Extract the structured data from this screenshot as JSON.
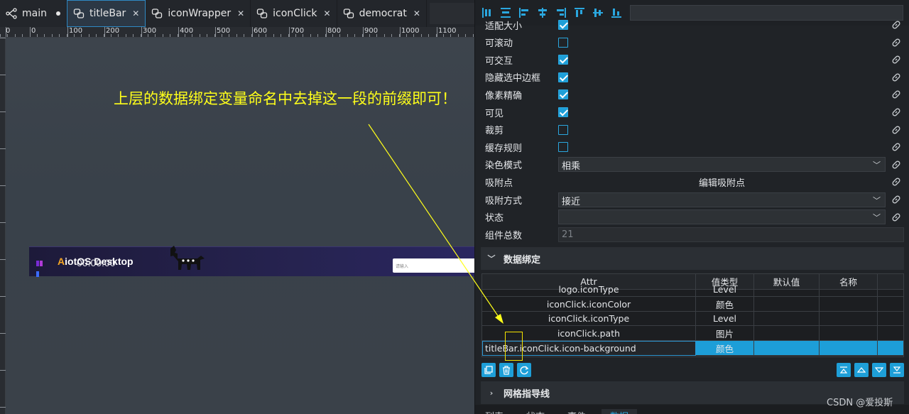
{
  "tabs": [
    {
      "label": "main",
      "dirty": true
    },
    {
      "label": "titleBar",
      "active": true
    },
    {
      "label": "iconWrapper"
    },
    {
      "label": "iconClick"
    },
    {
      "label": "democrat"
    }
  ],
  "ruler": {
    "labels": [
      "0",
      "0",
      "100",
      "200",
      "300",
      "400",
      "500",
      "600",
      "700",
      "800",
      "900",
      "1000",
      "1100"
    ]
  },
  "canvas": {
    "annotation": "上层的数据绑定变量命名中去掉这一段的前缀即可！",
    "preview": {
      "title_prefix": "A",
      "title_rest": "iotOS Desktop",
      "time": "00:00:00",
      "input_placeholder": "请输入"
    }
  },
  "toolbar": {
    "icons": [
      "align-left-edge-icon",
      "align-horizontal-center-icon",
      "align-left-icon",
      "align-center-icon",
      "align-right-icon",
      "align-top-icon",
      "align-middle-icon",
      "align-bottom-icon"
    ],
    "search_value": ""
  },
  "props": [
    {
      "label": "适配大小",
      "type": "checkbox",
      "checked": true
    },
    {
      "label": "可滚动",
      "type": "checkbox",
      "checked": false
    },
    {
      "label": "可交互",
      "type": "checkbox",
      "checked": true
    },
    {
      "label": "隐藏选中边框",
      "type": "checkbox",
      "checked": true
    },
    {
      "label": "像素精确",
      "type": "checkbox",
      "checked": true
    },
    {
      "label": "可见",
      "type": "checkbox",
      "checked": true
    },
    {
      "label": "裁剪",
      "type": "checkbox",
      "checked": false
    },
    {
      "label": "缓存规则",
      "type": "checkbox",
      "checked": false
    },
    {
      "label": "染色模式",
      "type": "select",
      "value": "相乘"
    },
    {
      "label": "吸附点",
      "type": "button",
      "value": "编辑吸附点"
    },
    {
      "label": "吸附方式",
      "type": "select",
      "value": "接近"
    },
    {
      "label": "状态",
      "type": "select",
      "value": ""
    },
    {
      "label": "组件总数",
      "type": "readonly",
      "value": "21"
    }
  ],
  "sections": {
    "data_binding": "数据绑定",
    "grid_guides": "网格指导线"
  },
  "binding_table": {
    "headers": [
      "Attr",
      "值类型",
      "默认值",
      "名称"
    ],
    "rows": [
      {
        "attr": "logo.iconType",
        "type": "Level",
        "default": "",
        "name": ""
      },
      {
        "attr": "iconClick.iconColor",
        "type": "颜色",
        "default": "",
        "name": ""
      },
      {
        "attr": "iconClick.iconType",
        "type": "Level",
        "default": "",
        "name": ""
      },
      {
        "attr": "iconClick.path",
        "type": "图片",
        "default": "",
        "name": ""
      },
      {
        "attr": "titleBar.iconClick.icon-background",
        "type": "颜色",
        "default": "",
        "name": "",
        "selected": true
      }
    ]
  },
  "bottom_tabs": [
    "列表",
    "状态",
    "事件",
    "数据"
  ],
  "watermark": "CSDN @爱投斯",
  "colors": {
    "accent": "#1e9fd8",
    "annotation": "#ffff1a",
    "panel_bg": "#202327"
  }
}
